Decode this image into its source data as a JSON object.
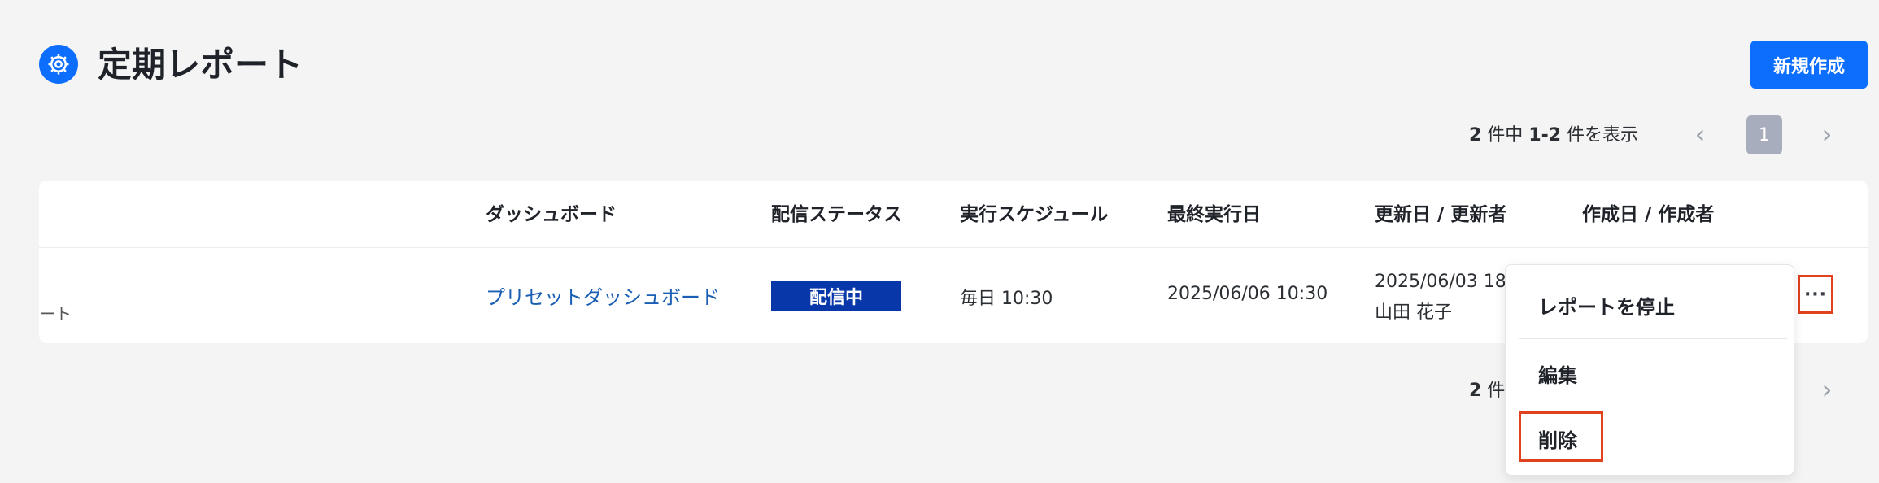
{
  "header": {
    "title": "定期レポート",
    "new_button": "新規作成",
    "title_icon": "gear-icon"
  },
  "pagination": {
    "total": "2",
    "total_suffix": " 件中 ",
    "range": "1-2",
    "range_suffix": " 件を表示",
    "current_page": "1",
    "bottom_total": "2",
    "bottom_suffix": " 件"
  },
  "table": {
    "columns": [
      "ダッシュボード",
      "配信ステータス",
      "実行スケジュール",
      "最終実行日",
      "更新日 / 更新者",
      "作成日 / 作成者"
    ],
    "rows": [
      {
        "name_fragment": "ート",
        "dashboard": "プリセットダッシュボード",
        "status": "配信中",
        "schedule": "毎日 10:30",
        "last_run": "2025/06/06 10:30",
        "updated_date": "2025/06/03 18",
        "updated_by": "山田 花子"
      }
    ]
  },
  "row_menu": {
    "more_label": "···",
    "items": [
      "レポートを停止",
      "編集",
      "削除"
    ]
  },
  "colors": {
    "primary": "#0d6efd",
    "status_badge": "#0737a8",
    "highlight": "#e0411f",
    "link": "#1a5fb4"
  }
}
